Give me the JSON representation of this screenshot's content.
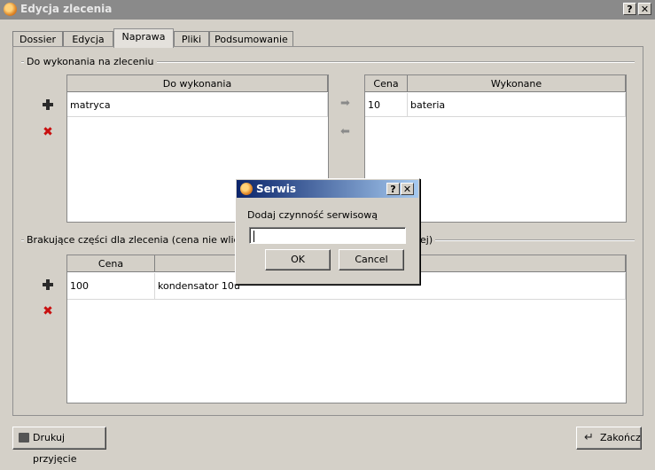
{
  "window": {
    "title": "Edycja zlecenia",
    "help": "?",
    "close": "✕"
  },
  "tabs": [
    {
      "label": "Dossier"
    },
    {
      "label": "Edycja"
    },
    {
      "label": "Naprawa"
    },
    {
      "label": "Pliki"
    },
    {
      "label": "Podsumowanie"
    }
  ],
  "todo_group": {
    "title": "Do wykonania na zleceniu",
    "todo_table": {
      "header": "Do wykonania",
      "rows": [
        "matryca"
      ]
    },
    "done_table": {
      "headers": [
        "Cena",
        "Wykonane"
      ],
      "rows": [
        [
          "10",
          "bateria"
        ]
      ]
    }
  },
  "missing_group": {
    "title_left": "Brakujące części dla zlecenia (cena nie wlicza się d",
    "title_right": "ej)",
    "table": {
      "headers": [
        "Cena",
        ""
      ],
      "rows": [
        [
          "100",
          "kondensator 10u"
        ]
      ]
    }
  },
  "footer": {
    "print_label": "Drukuj przyjęcie",
    "finish_label": "Zakończ"
  },
  "dialog": {
    "title": "Serwis",
    "prompt": "Dodaj czynność serwisową",
    "value": "",
    "ok": "OK",
    "cancel": "Cancel"
  }
}
